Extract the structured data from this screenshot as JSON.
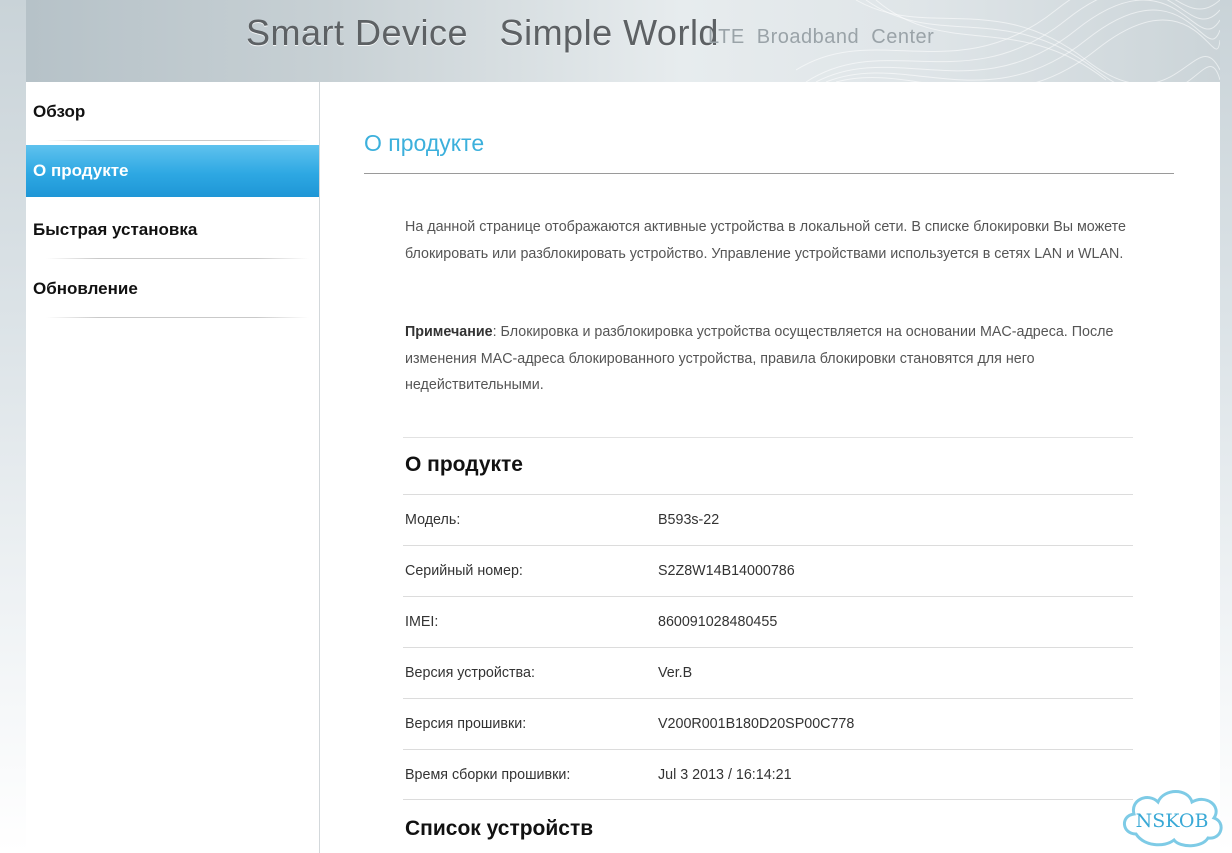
{
  "header": {
    "brand_main": "Smart Device   Simple World",
    "brand_sub": "LTE  Broadband  Center"
  },
  "sidebar": {
    "items": [
      {
        "label": "Обзор",
        "active": false
      },
      {
        "label": "О продукте",
        "active": true
      },
      {
        "label": "Быстрая установка",
        "active": false
      },
      {
        "label": "Обновление",
        "active": false
      }
    ]
  },
  "main": {
    "page_title": "О продукте",
    "description": "На данной странице отображаются активные устройства в локальной сети. В списке блокировки Вы можете блокировать или разблокировать устройство. Управление устройствами используется в сетях LAN и WLAN.",
    "note_label": "Примечание",
    "note_text": ": Блокировка и разблокировка устройства осуществляется на основании MAC-адреса. После изменения MAC-адреса блокированного устройства, правила блокировки становятся для него недействительными.",
    "product_section_title": "О продукте",
    "product_info": [
      {
        "key": "Модель:",
        "value": "B593s-22"
      },
      {
        "key": "Серийный номер:",
        "value": "S2Z8W14B14000786"
      },
      {
        "key": "IMEI:",
        "value": "860091028480455"
      },
      {
        "key": "Версия устройства:",
        "value": "Ver.B"
      },
      {
        "key": "Версия прошивки:",
        "value": "V200R001B180D20SP00C778"
      },
      {
        "key": "Время сборки прошивки:",
        "value": "Jul 3 2013 / 16:14:21"
      }
    ],
    "devices_section_title": "Список устройств"
  },
  "watermark": {
    "text": "NSKOB"
  },
  "colors": {
    "accent": "#3cb0dc",
    "active_nav": "#2ea8e3"
  }
}
